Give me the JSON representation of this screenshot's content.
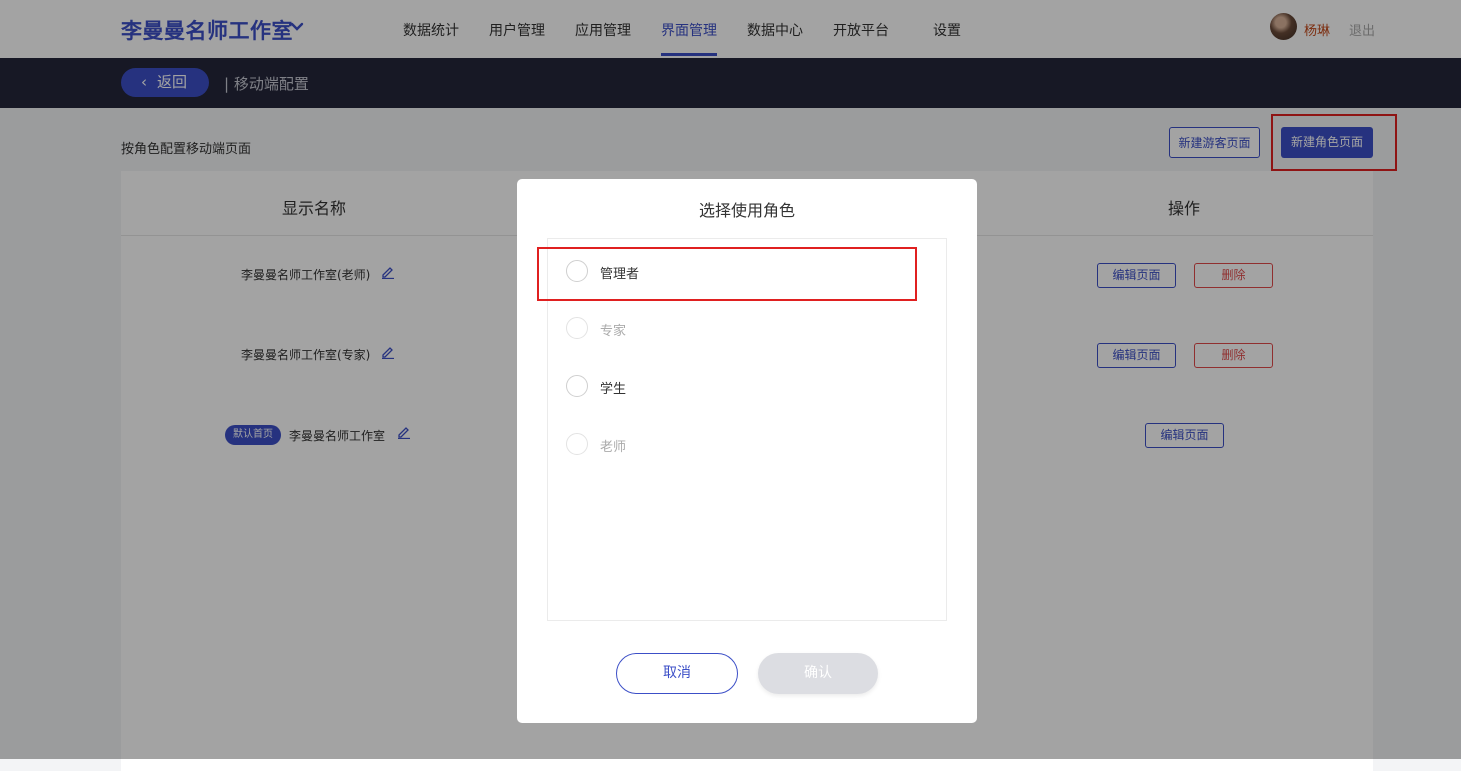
{
  "header": {
    "brand": "李曼曼名师工作室",
    "nav": [
      "数据统计",
      "用户管理",
      "应用管理",
      "界面管理",
      "数据中心",
      "开放平台",
      "设置"
    ],
    "active_nav": "界面管理",
    "user": {
      "name": "杨琳",
      "logout": "退出"
    }
  },
  "subbar": {
    "back_label": "返回",
    "breadcrumb": "| 移动端配置"
  },
  "page": {
    "description": "按角色配置移动端页面",
    "guest_page_button": "新建游客页面",
    "role_page_button": "新建角色页面"
  },
  "table": {
    "columns": {
      "name": "显示名称",
      "actions": "操作"
    },
    "rows": [
      {
        "name": "李曼曼名师工作室(老师)",
        "edit": "编辑页面",
        "delete": "删除"
      },
      {
        "name": "李曼曼名师工作室(专家)",
        "edit": "编辑页面",
        "delete": "删除"
      },
      {
        "badge": "默认首页",
        "name": "李曼曼名师工作室",
        "edit": "编辑页面"
      }
    ]
  },
  "modal": {
    "title": "选择使用角色",
    "options": [
      {
        "label": "管理者",
        "disabled": false
      },
      {
        "label": "专家",
        "disabled": true
      },
      {
        "label": "学生",
        "disabled": false
      },
      {
        "label": "老师",
        "disabled": true
      }
    ],
    "cancel": "取消",
    "confirm": "确认"
  },
  "colors": {
    "accent": "#3c4fc7",
    "danger": "#e24a4a",
    "highlight": "#e02020",
    "dark_bar": "#24273a"
  }
}
